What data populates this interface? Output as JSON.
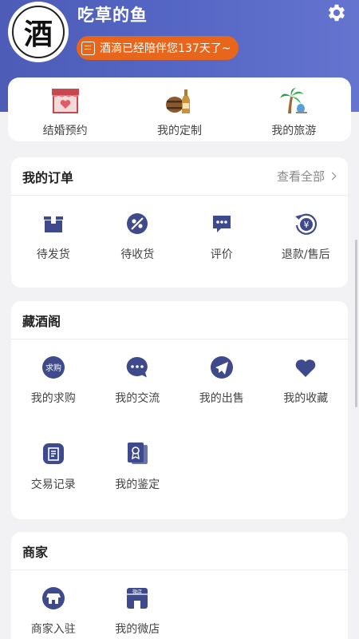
{
  "profile": {
    "avatar_text": "酒",
    "username": "吃草的鱼",
    "badge_text": "酒滴已经陪伴您137天了~"
  },
  "quick_links": [
    {
      "label": "结婚预约",
      "icon": "wedding-shop-icon"
    },
    {
      "label": "我的定制",
      "icon": "barrel-bottle-icon"
    },
    {
      "label": "我的旅游",
      "icon": "palm-tree-icon"
    }
  ],
  "orders": {
    "title": "我的订单",
    "more": "查看全部",
    "items": [
      {
        "label": "待发货",
        "icon": "box-icon"
      },
      {
        "label": "待收货",
        "icon": "delivery-icon"
      },
      {
        "label": "评价",
        "icon": "comment-icon"
      },
      {
        "label": "退款/售后",
        "icon": "refund-icon"
      }
    ]
  },
  "cellar": {
    "title": "藏酒阁",
    "items": [
      {
        "label": "我的求购",
        "icon": "purchase-icon",
        "icon_text": "求购"
      },
      {
        "label": "我的交流",
        "icon": "chat-icon"
      },
      {
        "label": "我的出售",
        "icon": "paper-plane-icon"
      },
      {
        "label": "我的收藏",
        "icon": "heart-icon"
      },
      {
        "label": "交易记录",
        "icon": "record-icon"
      },
      {
        "label": "我的鉴定",
        "icon": "certificate-icon"
      }
    ]
  },
  "merchant": {
    "title": "商家",
    "items": [
      {
        "label": "商家入驻",
        "icon": "store-icon"
      },
      {
        "label": "我的微店",
        "icon": "micro-store-icon",
        "icon_text": "微店"
      }
    ]
  },
  "colors": {
    "accent": "#3e4a8c",
    "header": "#5566c4",
    "badge": "#e8661c"
  }
}
